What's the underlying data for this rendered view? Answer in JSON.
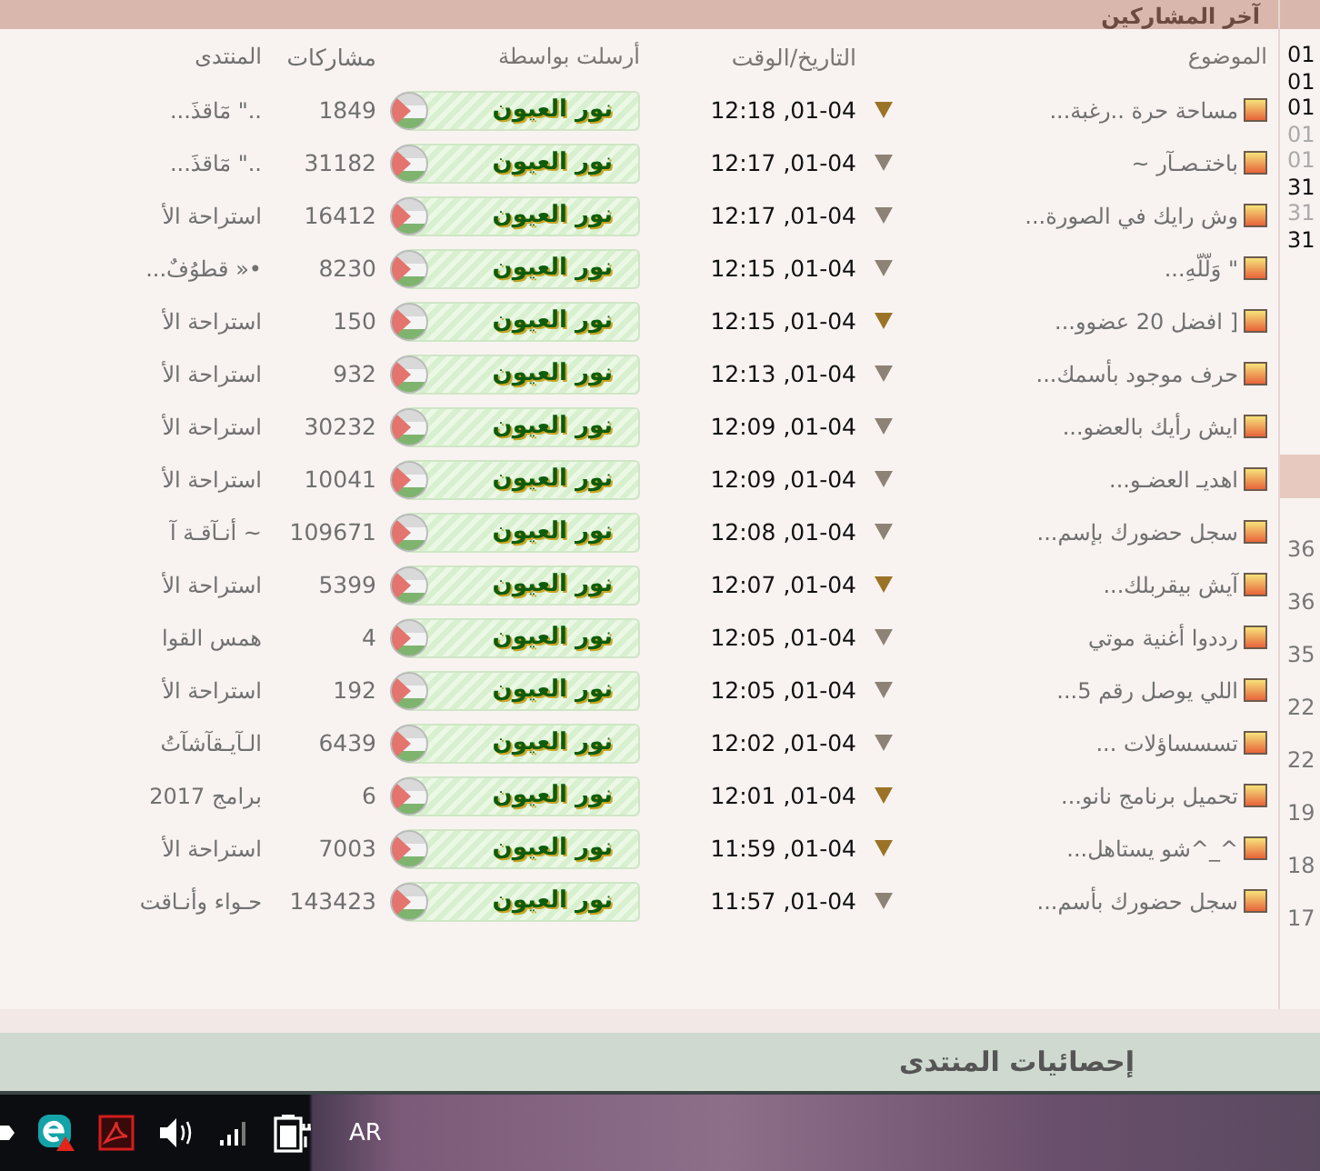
{
  "section_title": "آخر المشاركين",
  "columns": {
    "topic": "الموضوع",
    "datetime": "التاريخ/الوقت",
    "sent_by": "أرسلت بواسطة",
    "posts": "مشاركات",
    "forum": "المنتدى"
  },
  "rows": [
    {
      "topic": "مساحة حرة ..رغبة...",
      "date": "01-04, 12:18",
      "highlight": true,
      "author": "نور العيون",
      "posts": "1849",
      "forum": "..\" مٓاقذَ..."
    },
    {
      "topic": "باختـصـآر ~",
      "date": "01-04, 12:17",
      "highlight": false,
      "author": "نور العيون",
      "posts": "31182",
      "forum": "..\" مٓاقذَ..."
    },
    {
      "topic": "وش رايك في الصورة...",
      "date": "01-04, 12:17",
      "highlight": false,
      "author": "نور العيون",
      "posts": "16412",
      "forum": "استراحة الأ"
    },
    {
      "topic": "\" وَلّلّهِ...",
      "date": "01-04, 12:15",
      "highlight": false,
      "author": "نور العيون",
      "posts": "8230",
      "forum": "•« قطوُفٌ..."
    },
    {
      "topic": "[ افضل 20 عضوو...",
      "date": "01-04, 12:15",
      "highlight": true,
      "author": "نور العيون",
      "posts": "150",
      "forum": "استراحة الأ"
    },
    {
      "topic": "حرف موجود بأسمك...",
      "date": "01-04, 12:13",
      "highlight": false,
      "author": "نور العيون",
      "posts": "932",
      "forum": "استراحة الأ"
    },
    {
      "topic": "ايش رأيك بالعضو...",
      "date": "01-04, 12:09",
      "highlight": false,
      "author": "نور العيون",
      "posts": "30232",
      "forum": "استراحة الأ"
    },
    {
      "topic": "اهديـ العضـو...",
      "date": "01-04, 12:09",
      "highlight": false,
      "author": "نور العيون",
      "posts": "10041",
      "forum": "استراحة الأ"
    },
    {
      "topic": "سجل حضورك بإسم...",
      "date": "01-04, 12:08",
      "highlight": false,
      "author": "نور العيون",
      "posts": "109671",
      "forum": "~ أنـآقـة آ"
    },
    {
      "topic": "آيش بيقربلك...",
      "date": "01-04, 12:07",
      "highlight": true,
      "author": "نور العيون",
      "posts": "5399",
      "forum": "استراحة الأ"
    },
    {
      "topic": "رددوا أغنية موتي",
      "date": "01-04, 12:05",
      "highlight": false,
      "author": "نور العيون",
      "posts": "4",
      "forum": "همس القوا"
    },
    {
      "topic": "اللي يوصل رقم 5...",
      "date": "01-04, 12:05",
      "highlight": false,
      "author": "نور العيون",
      "posts": "192",
      "forum": "استراحة الأ"
    },
    {
      "topic": "تسسساؤلات ...",
      "date": "01-04, 12:02",
      "highlight": false,
      "author": "نور العيون",
      "posts": "6439",
      "forum": "الـآيـقآشآتُ"
    },
    {
      "topic": "تحميل برنامج نانو...",
      "date": "01-04, 12:01",
      "highlight": true,
      "author": "نور العيون",
      "posts": "6",
      "forum": "برامج 2017"
    },
    {
      "topic": "^_^شو يستاهل...",
      "date": "01-04, 11:59",
      "highlight": true,
      "author": "نور العيون",
      "posts": "7003",
      "forum": "استراحة الأ"
    },
    {
      "topic": "سجل حضورك بأسم...",
      "date": "01-04, 11:57",
      "highlight": false,
      "author": "نور العيون",
      "posts": "143423",
      "forum": "حـواء وأنـاقت"
    }
  ],
  "side_top": [
    {
      "text": "01",
      "dim": false
    },
    {
      "text": "01",
      "dim": false
    },
    {
      "text": "01",
      "dim": false
    },
    {
      "text": "01",
      "dim": true
    },
    {
      "text": "01",
      "dim": true
    },
    {
      "text": "31",
      "dim": false
    },
    {
      "text": "31",
      "dim": true
    },
    {
      "text": "31",
      "dim": false
    }
  ],
  "side_bottom": [
    {
      "text": "36",
      "dim": false
    },
    {
      "text": "36",
      "dim": false
    },
    {
      "text": "35",
      "dim": false
    },
    {
      "text": "22",
      "dim": false
    },
    {
      "text": "22",
      "dim": false
    },
    {
      "text": "19",
      "dim": false
    },
    {
      "text": "18",
      "dim": false
    },
    {
      "text": "17",
      "dim": false
    }
  ],
  "stats_title": "إحصائيات المنتدى",
  "taskbar": {
    "language": "AR"
  }
}
